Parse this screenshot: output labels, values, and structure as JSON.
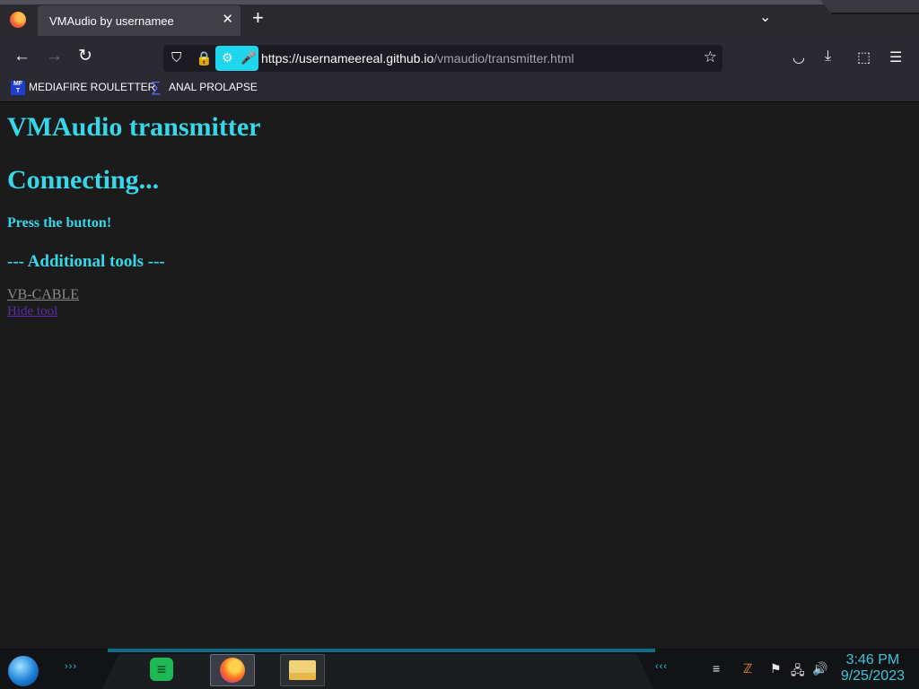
{
  "browser": {
    "tab_title": "VMAudio by usernamee",
    "tab_close": "✕",
    "new_tab": "+",
    "tab_list": "⌄",
    "url_host": "https://usernameereal.github.io",
    "url_path": "/vmaudio/transmitter.html",
    "icons": {
      "back": "←",
      "forward": "→",
      "reload": "↻",
      "shield": "⛉",
      "lock": "🔒",
      "perm": "⚙",
      "mic": "🎤",
      "star": "☆",
      "pocket": "◡",
      "download": "⤓",
      "extensions": "⬚",
      "menu": "☰"
    }
  },
  "bookmarks": [
    {
      "label": "MEDIAFIRE ROULETTER",
      "icon_text": "MF T"
    },
    {
      "label": "ANAL PROLAPSE",
      "icon_text": "∑"
    }
  ],
  "page": {
    "title": "VMAudio transmitter",
    "status": "Connecting...",
    "prompt": "Press the button!",
    "section_title": "--- Additional tools ---",
    "link_vbcable": "VB-CABLE",
    "link_hide": "Hide tool"
  },
  "taskbar": {
    "chevrons_left": "›››",
    "chevrons_right": "‹‹‹",
    "spotify_glyph": "≡",
    "tray": {
      "show_desktop": "≡",
      "flag": "⚑",
      "network": "🖧",
      "volume": "🔊",
      "app": "ℤ"
    },
    "time": "3:46 PM",
    "date": "9/25/2023"
  }
}
